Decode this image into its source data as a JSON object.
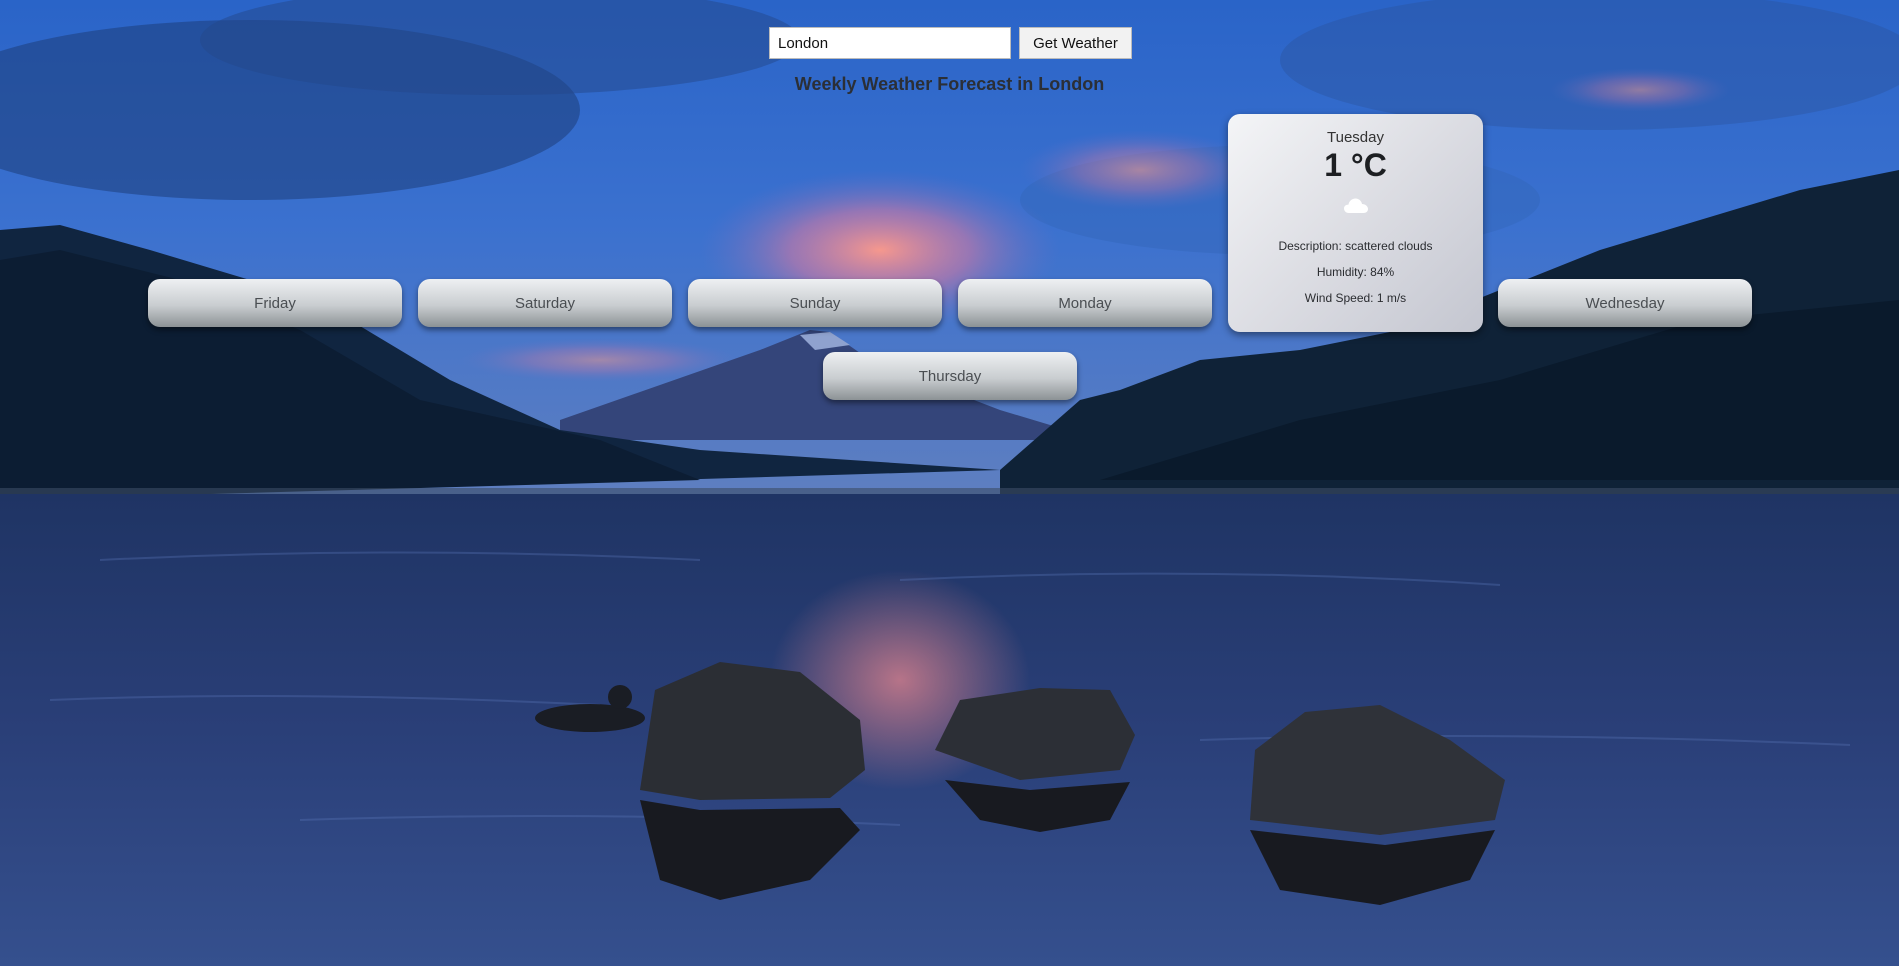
{
  "search": {
    "value": "London",
    "button_label": "Get Weather"
  },
  "page_title": "Weekly Weather Forecast in London",
  "days": {
    "friday": "Friday",
    "saturday": "Saturday",
    "sunday": "Sunday",
    "monday": "Monday",
    "wednesday": "Wednesday",
    "thursday": "Thursday"
  },
  "selected_day": {
    "name": "Tuesday",
    "temperature": "1 °C",
    "icon": "cloud-icon",
    "description": "Description: scattered clouds",
    "humidity": "Humidity: 84%",
    "wind_speed": "Wind Speed: 1 m/s"
  },
  "colors": {
    "card_bg": "#dcdde3",
    "pill_top": "#eef0f2",
    "pill_bottom": "#8c9295",
    "title_text": "#2b2f36"
  }
}
